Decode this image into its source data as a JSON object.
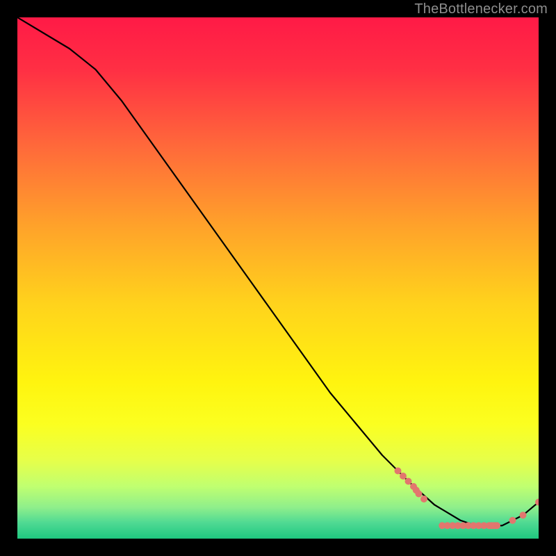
{
  "watermark": "TheBottlenecker.com",
  "chart_data": {
    "type": "line",
    "title": "",
    "xlabel": "",
    "ylabel": "",
    "xlim": [
      0,
      100
    ],
    "ylim": [
      0,
      100
    ],
    "series": [
      {
        "name": "curve",
        "color": "#000000",
        "x": [
          0,
          5,
          10,
          15,
          20,
          25,
          30,
          35,
          40,
          45,
          50,
          55,
          60,
          65,
          70,
          75,
          80,
          85,
          88,
          90,
          93,
          97,
          100
        ],
        "y": [
          100,
          97,
          94,
          90,
          84,
          77,
          70,
          63,
          56,
          49,
          42,
          35,
          28,
          22,
          16,
          11,
          6.5,
          3.5,
          2.5,
          2.5,
          2.5,
          4.5,
          7
        ]
      }
    ],
    "markers": {
      "name": "highlight-points",
      "color": "#e2766e",
      "radius": 5,
      "points": [
        {
          "x": 73,
          "y": 13.0
        },
        {
          "x": 74,
          "y": 12.0
        },
        {
          "x": 75,
          "y": 11.0
        },
        {
          "x": 76,
          "y": 10.0
        },
        {
          "x": 76.5,
          "y": 9.3
        },
        {
          "x": 77,
          "y": 8.6
        },
        {
          "x": 78,
          "y": 7.6
        },
        {
          "x": 81.5,
          "y": 2.5
        },
        {
          "x": 82.5,
          "y": 2.5
        },
        {
          "x": 83.5,
          "y": 2.5
        },
        {
          "x": 84.5,
          "y": 2.5
        },
        {
          "x": 85.5,
          "y": 2.5
        },
        {
          "x": 86.5,
          "y": 2.5
        },
        {
          "x": 87.5,
          "y": 2.5
        },
        {
          "x": 88.5,
          "y": 2.5
        },
        {
          "x": 89.5,
          "y": 2.5
        },
        {
          "x": 90.5,
          "y": 2.5
        },
        {
          "x": 91.0,
          "y": 2.5
        },
        {
          "x": 91.5,
          "y": 2.5
        },
        {
          "x": 92.0,
          "y": 2.5
        },
        {
          "x": 95.0,
          "y": 3.5
        },
        {
          "x": 97.0,
          "y": 4.5
        },
        {
          "x": 100.0,
          "y": 7.0
        }
      ]
    },
    "gradient_stops": [
      {
        "offset": 0.0,
        "color": "#ff1a46"
      },
      {
        "offset": 0.1,
        "color": "#ff2f44"
      },
      {
        "offset": 0.25,
        "color": "#ff6a3a"
      },
      {
        "offset": 0.4,
        "color": "#ffa22a"
      },
      {
        "offset": 0.55,
        "color": "#ffd31c"
      },
      {
        "offset": 0.7,
        "color": "#fff40f"
      },
      {
        "offset": 0.78,
        "color": "#fbff20"
      },
      {
        "offset": 0.85,
        "color": "#e6ff4a"
      },
      {
        "offset": 0.9,
        "color": "#c0ff70"
      },
      {
        "offset": 0.94,
        "color": "#8fef8b"
      },
      {
        "offset": 0.97,
        "color": "#4ed993"
      },
      {
        "offset": 1.0,
        "color": "#1fc87f"
      }
    ]
  }
}
